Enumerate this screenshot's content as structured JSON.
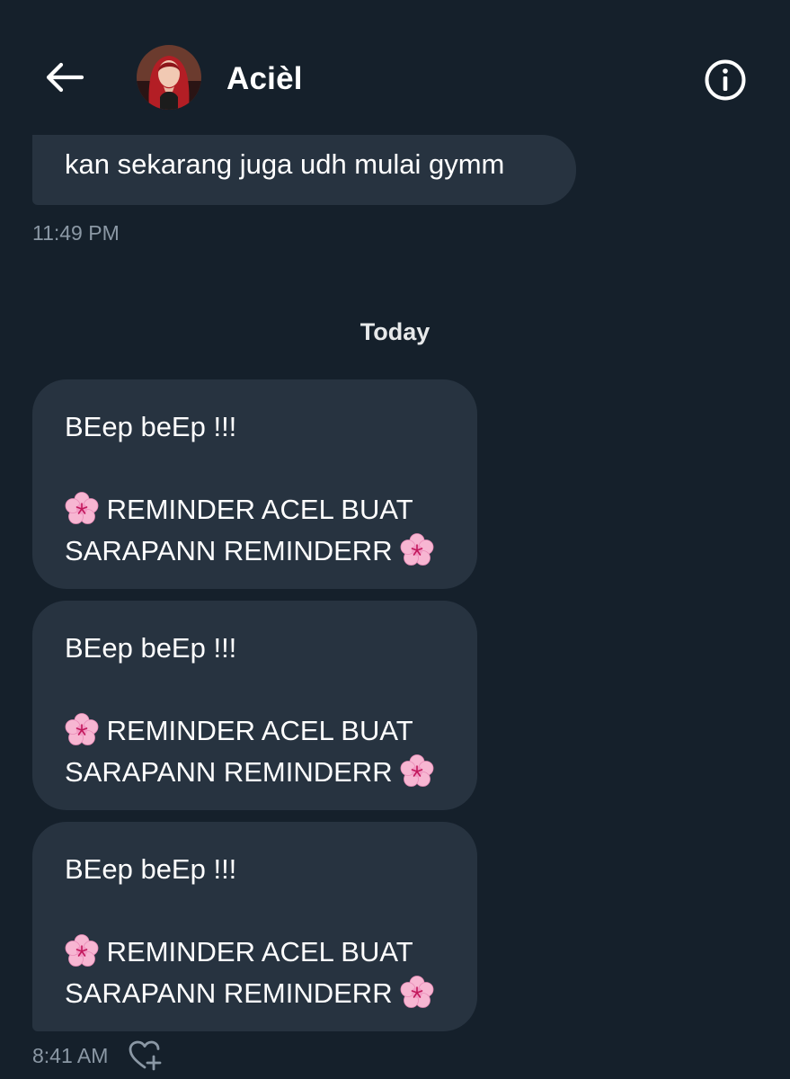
{
  "header": {
    "contact_name": "Acièl"
  },
  "icons": {
    "back": "arrow-left-icon",
    "info": "info-circle-icon",
    "flower": "cherry-blossom-icon",
    "react": "heart-plus-icon"
  },
  "colors": {
    "background": "#15202b",
    "bubble": "#273340",
    "timestamp": "#8b98a5",
    "flower_petal": "#f7b6d2"
  },
  "messages_previous": {
    "text": "kan sekarang juga udh mulai gymm",
    "timestamp": "11:49 PM"
  },
  "date_separator": "Today",
  "messages_today": [
    {
      "line1": "BEep beEp !!!",
      "line2": "REMINDER ACEL BUAT",
      "line3": "SARAPANN REMINDERR"
    },
    {
      "line1": "BEep beEp !!!",
      "line2": "REMINDER ACEL BUAT",
      "line3": "SARAPANN REMINDERR"
    },
    {
      "line1": "BEep beEp !!!",
      "line2": "REMINDER ACEL BUAT",
      "line3": "SARAPANN REMINDERR"
    }
  ],
  "last_timestamp": "8:41 AM"
}
